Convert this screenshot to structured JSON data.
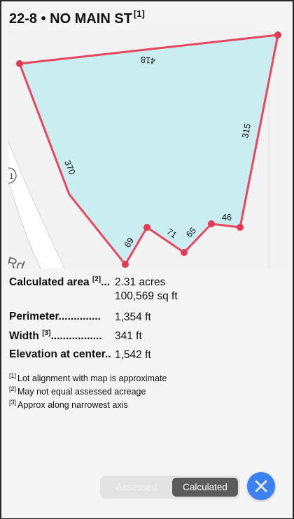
{
  "header": {
    "title": "22-8 • NO MAIN ST",
    "footnote": "[1]"
  },
  "map": {
    "edge_labels": [
      "418",
      "315",
      "370",
      "69",
      "71",
      "65",
      "46"
    ],
    "road_label": "Rd",
    "circle_label": "1",
    "colors": {
      "fill": "#c9edf1",
      "outline": "#e8465c",
      "vertex": "#e23a52"
    }
  },
  "stats": [
    {
      "label": "Calculated area",
      "footnote": "[2]",
      "dots": "...",
      "value": "2.31 acres",
      "value2": "100,569 sq ft"
    },
    {
      "label": "Perimeter",
      "footnote": "",
      "dots": "..............",
      "value": "1,354 ft"
    },
    {
      "label": "Width",
      "footnote": "[3]",
      "dots": ".................",
      "value": "341 ft"
    },
    {
      "label": "Elevation at center",
      "footnote": "",
      "dots": "..",
      "value": "1,542 ft"
    }
  ],
  "notes": [
    {
      "mark": "[1]",
      "text": "Lot alignment with map is approximate"
    },
    {
      "mark": "[2]",
      "text": "May not equal assessed acreage"
    },
    {
      "mark": "[3]",
      "text": "Approx along narrowest axis"
    }
  ],
  "toggle": {
    "assessed_label": "Assessed",
    "calculated_label": "Calculated",
    "selected": "Calculated"
  },
  "close_button": {
    "icon": "close-icon",
    "color": "#3b82f0"
  }
}
